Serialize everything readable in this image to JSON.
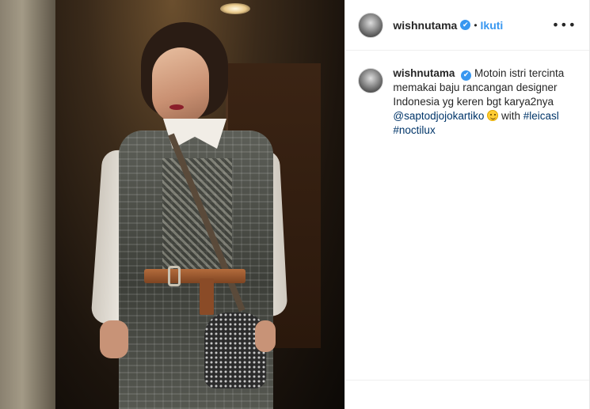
{
  "post": {
    "username": "wishnutama",
    "verified_glyph": "✔",
    "separator": "•",
    "follow_label": "Ikuti",
    "more_glyph": "•••",
    "caption": {
      "username": "wishnutama",
      "text_part1": "Motoin istri tercinta memakai baju rancangan designer Indonesia yg keren bgt karya2nya",
      "mention": "@saptodjojokartiko",
      "text_part2": "with",
      "hashtag1": "#leicasl",
      "hashtag2": "#noctilux",
      "emoji_icon": "smiling-face-emoji"
    }
  },
  "colors": {
    "link_blue": "#3897f0",
    "mention_blue": "#003569",
    "text": "#262626"
  }
}
